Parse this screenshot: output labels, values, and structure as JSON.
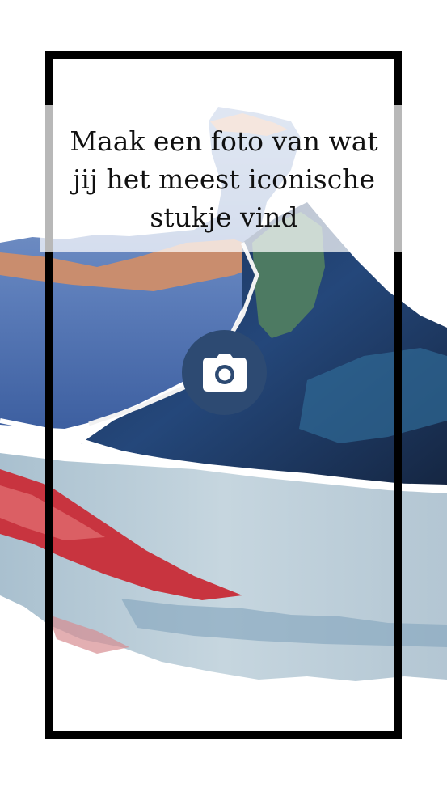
{
  "prompt": {
    "text": "Maak een foto van wat jij het meest iconische stukje vind"
  },
  "camera_button": {
    "icon": "camera-icon",
    "color": "#2d4a72"
  },
  "colors": {
    "frame": "#000000",
    "caption_overlay": "#ffffff"
  }
}
